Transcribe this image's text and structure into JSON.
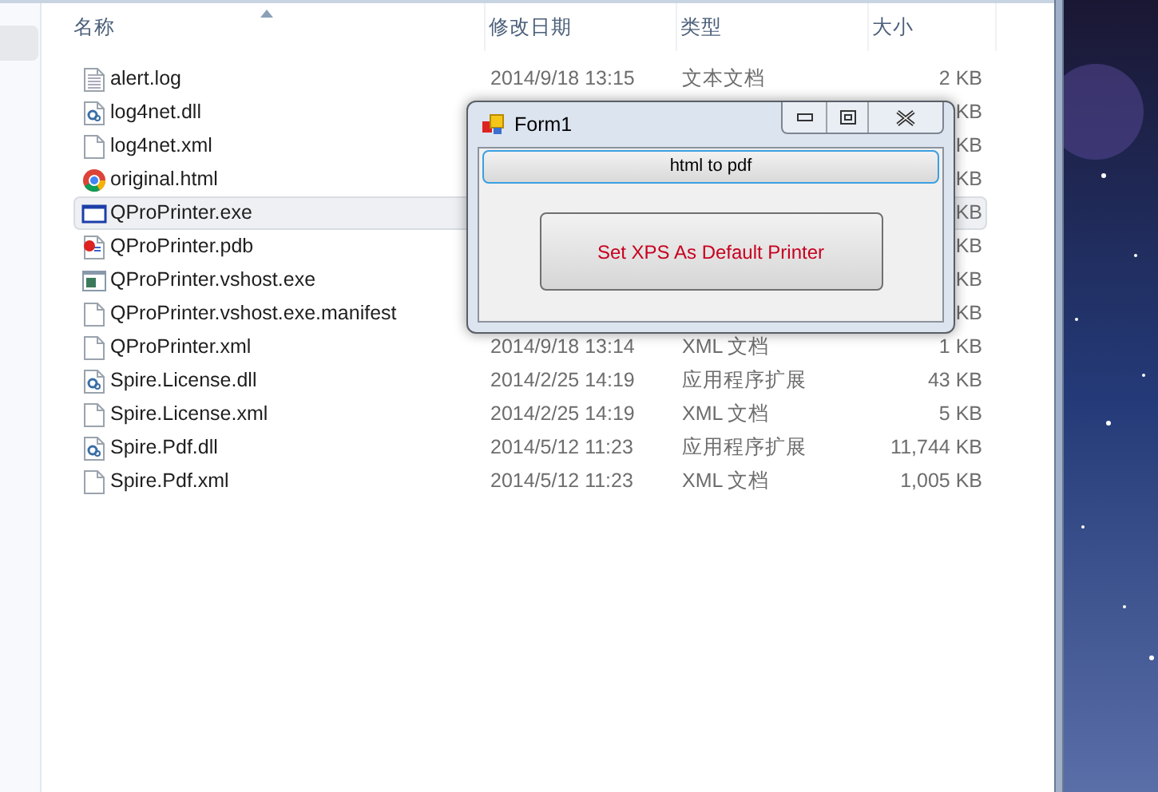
{
  "explorer": {
    "columns": [
      {
        "label": "名称"
      },
      {
        "label": "修改日期"
      },
      {
        "label": "类型"
      },
      {
        "label": "大小"
      }
    ],
    "rows": [
      {
        "kind": "text",
        "name": "alert.log",
        "date": "2014/9/18 13:15",
        "type": "文本文档",
        "size": "2 KB",
        "selected": false
      },
      {
        "kind": "dll",
        "name": "log4net.dll",
        "size": "KB",
        "selected": false
      },
      {
        "kind": "file",
        "name": "log4net.xml",
        "size": "KB",
        "selected": false
      },
      {
        "kind": "browser",
        "name": "original.html",
        "size": "KB",
        "selected": false
      },
      {
        "kind": "exe",
        "name": "QProPrinter.exe",
        "size": "KB",
        "selected": true
      },
      {
        "kind": "pdb",
        "name": "QProPrinter.pdb",
        "size": "KB",
        "selected": false
      },
      {
        "kind": "app",
        "name": "QProPrinter.vshost.exe",
        "size": "KB",
        "selected": false
      },
      {
        "kind": "file",
        "name": "QProPrinter.vshost.exe.manifest",
        "size": "KB",
        "selected": false
      },
      {
        "kind": "file",
        "name": "QProPrinter.xml",
        "date": "2014/9/18 13:14",
        "type": "XML 文档",
        "size": "1 KB",
        "selected": false
      },
      {
        "kind": "dll",
        "name": "Spire.License.dll",
        "date": "2014/2/25 14:19",
        "type": "应用程序扩展",
        "size": "43 KB",
        "selected": false
      },
      {
        "kind": "file",
        "name": "Spire.License.xml",
        "date": "2014/2/25 14:19",
        "type": "XML 文档",
        "size": "5 KB",
        "selected": false
      },
      {
        "kind": "dll",
        "name": "Spire.Pdf.dll",
        "date": "2014/5/12 11:23",
        "type": "应用程序扩展",
        "size": "11,744 KB",
        "selected": false
      },
      {
        "kind": "file",
        "name": "Spire.Pdf.xml",
        "date": "2014/5/12 11:23",
        "type": "XML 文档",
        "size": "1,005 KB",
        "selected": false
      }
    ]
  },
  "dialog": {
    "title": "Form1",
    "buttons": [
      {
        "label": "html to pdf",
        "focused": true
      },
      {
        "label": "Set XPS As Default Printer",
        "focused": false
      }
    ]
  }
}
